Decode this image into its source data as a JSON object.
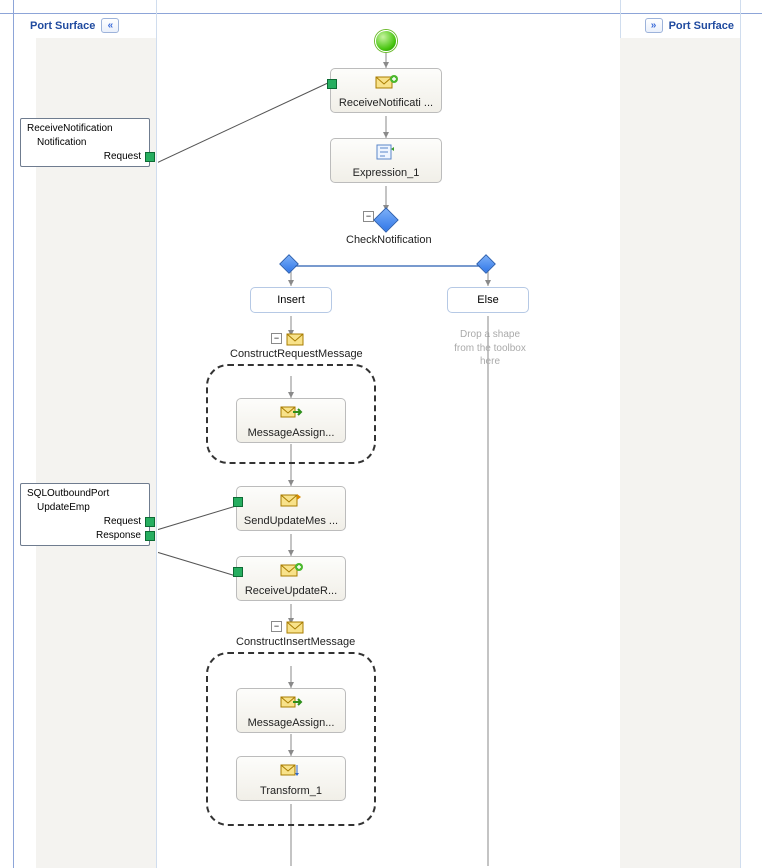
{
  "port_surface_label": "Port Surface",
  "ports": {
    "receive_notification": {
      "name": "ReceiveNotification",
      "channel": "Notification",
      "operations": [
        "Request"
      ]
    },
    "sql_outbound": {
      "name": "SQLOutboundPort",
      "channel": "UpdateEmp",
      "operations": [
        "Request",
        "Response"
      ]
    }
  },
  "shapes": {
    "receive_notification": "ReceiveNotificati ...",
    "expression_1": "Expression_1",
    "check_notification": "CheckNotification",
    "insert_branch": "Insert",
    "else_branch": "Else",
    "else_placeholder": "Drop a shape\nfrom the toolbox\nhere",
    "construct_request_scope": "ConstructRequestMessage",
    "message_assign_1": "MessageAssign...",
    "send_update": "SendUpdateMes ...",
    "receive_update": "ReceiveUpdateR...",
    "construct_insert_scope": "ConstructInsertMessage",
    "message_assign_2": "MessageAssign...",
    "transform_1": "Transform_1"
  }
}
